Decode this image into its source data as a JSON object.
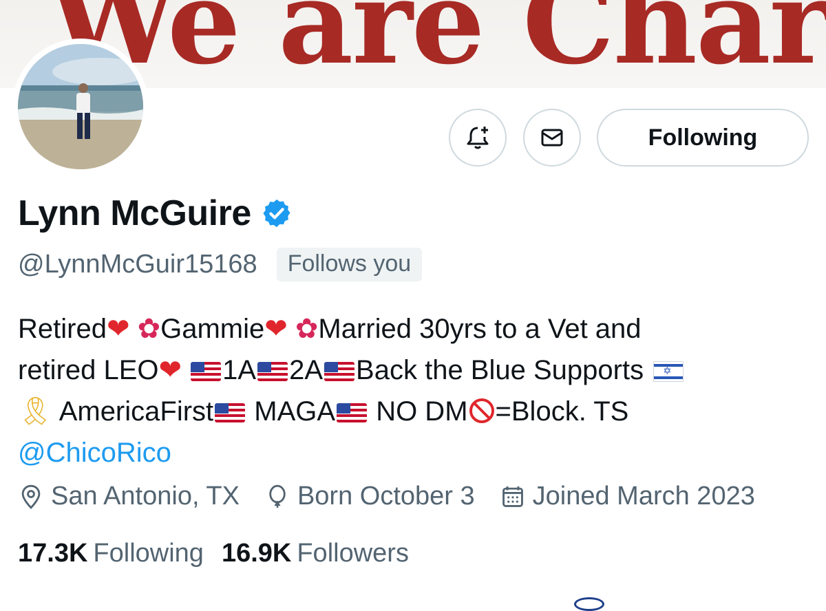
{
  "banner": {
    "text": "We are Charlie"
  },
  "profile": {
    "display_name": "Lynn McGuire",
    "handle": "@LynnMcGuir15168",
    "follows_you": "Follows you",
    "follow_button": "Following",
    "bio": {
      "line1": [
        "Retired",
        "Gammie",
        "Married 30yrs to a Vet and"
      ],
      "line2": [
        "retired LEO",
        "1A",
        "2A",
        "Back the Blue Supports"
      ],
      "line3": [
        "AmericaFirst",
        "MAGA",
        "NO DM",
        "=Block. TS"
      ],
      "mention": "@ChicoRico"
    },
    "location": "San Antonio, TX",
    "birthday": "Born October 3",
    "joined": "Joined March 2023",
    "following_count": "17.3K",
    "following_label": "Following",
    "followers_count": "16.9K",
    "followers_label": "Followers"
  },
  "icons": [
    "notification-bell-plus-icon",
    "mail-icon",
    "verified-badge-icon",
    "location-pin-icon",
    "balloon-icon",
    "calendar-icon"
  ],
  "colors": {
    "accent": "#1d9bf0",
    "muted": "#536471",
    "banner_red": "#a82a25"
  }
}
